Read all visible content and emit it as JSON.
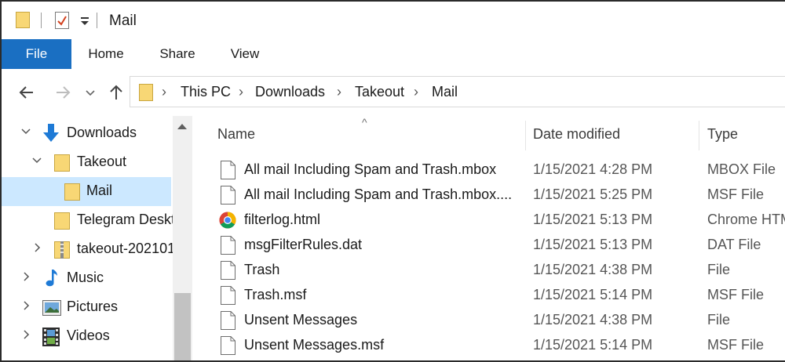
{
  "window": {
    "title": "Mail"
  },
  "ribbon": {
    "tabs": [
      "File",
      "Home",
      "Share",
      "View"
    ]
  },
  "address": {
    "crumbs": [
      "This PC",
      "Downloads",
      "Takeout",
      "Mail"
    ]
  },
  "nav_tree": [
    {
      "label": "Downloads",
      "icon": "download-arrow-icon",
      "expanded": true
    },
    {
      "label": "Takeout",
      "icon": "folder-icon",
      "expanded": true
    },
    {
      "label": "Mail",
      "icon": "folder-icon",
      "selected": true
    },
    {
      "label": "Telegram Deskt",
      "icon": "folder-icon"
    },
    {
      "label": "takeout-202101",
      "icon": "zip-folder-icon",
      "expanded": false
    },
    {
      "label": "Music",
      "icon": "music-note-icon",
      "expanded": false
    },
    {
      "label": "Pictures",
      "icon": "pictures-icon",
      "expanded": false
    },
    {
      "label": "Videos",
      "icon": "videos-icon",
      "expanded": false
    }
  ],
  "columns": {
    "name": "Name",
    "date": "Date modified",
    "type": "Type"
  },
  "files": [
    {
      "name": "All mail Including Spam and Trash.mbox",
      "date": "1/15/2021 4:28 PM",
      "type": "MBOX File",
      "icon": "file-icon"
    },
    {
      "name": "All mail Including Spam and Trash.mbox....",
      "date": "1/15/2021 5:25 PM",
      "type": "MSF File",
      "icon": "file-icon"
    },
    {
      "name": "filterlog.html",
      "date": "1/15/2021 5:13 PM",
      "type": "Chrome HTM",
      "icon": "chrome-icon"
    },
    {
      "name": "msgFilterRules.dat",
      "date": "1/15/2021 5:13 PM",
      "type": "DAT File",
      "icon": "file-icon"
    },
    {
      "name": "Trash",
      "date": "1/15/2021 4:38 PM",
      "type": "File",
      "icon": "file-icon"
    },
    {
      "name": "Trash.msf",
      "date": "1/15/2021 5:14 PM",
      "type": "MSF File",
      "icon": "file-icon"
    },
    {
      "name": "Unsent Messages",
      "date": "1/15/2021 4:38 PM",
      "type": "File",
      "icon": "file-icon"
    },
    {
      "name": "Unsent Messages.msf",
      "date": "1/15/2021 5:14 PM",
      "type": "MSF File",
      "icon": "file-icon"
    }
  ],
  "colors": {
    "accent": "#1a6fc2",
    "selection": "#cce8ff",
    "folder": "#f8d775"
  }
}
